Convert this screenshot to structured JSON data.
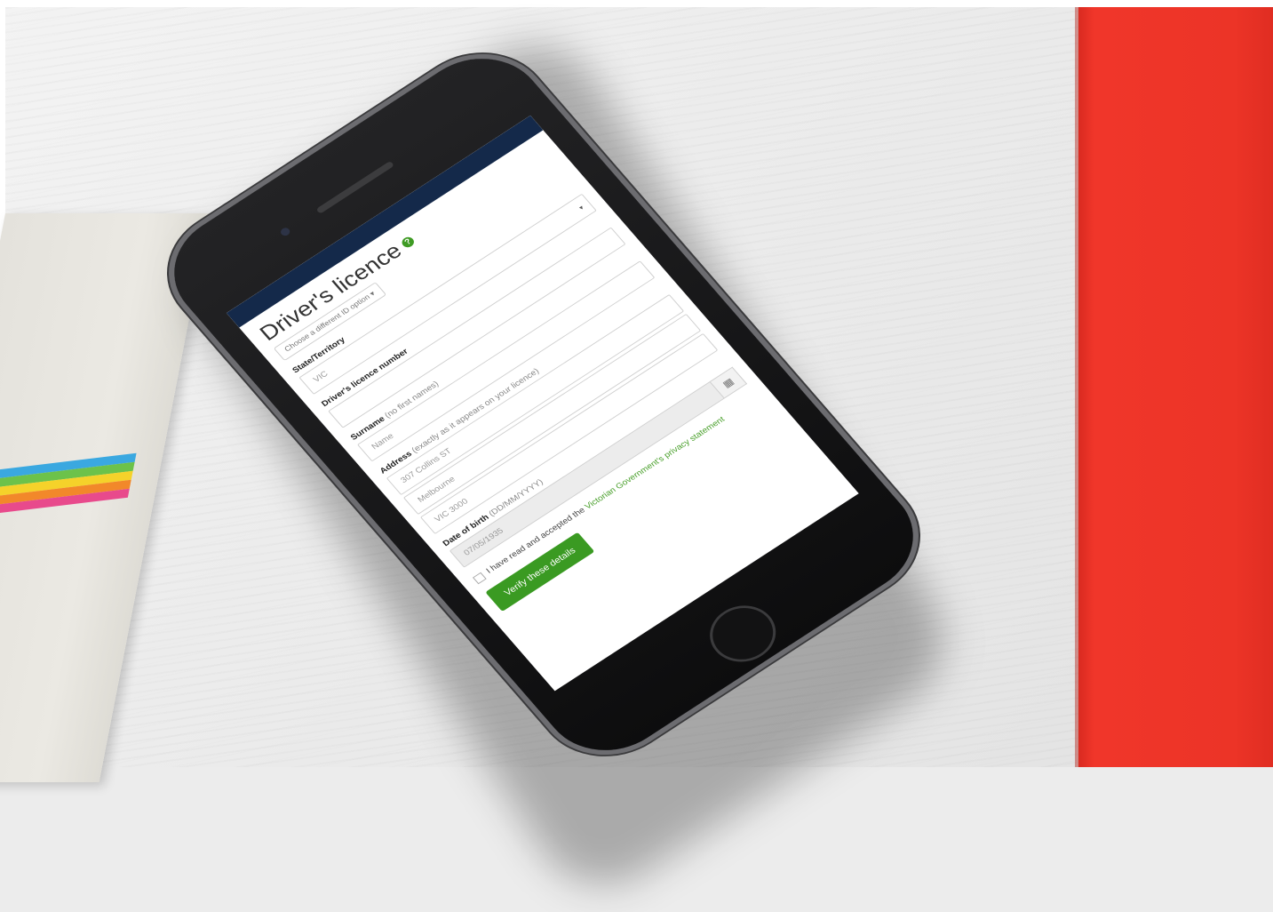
{
  "form": {
    "title": "Driver's licence",
    "id_option": "Choose a different ID option",
    "state_label": "State/Territory",
    "state_value": "VIC",
    "licence_label": "Driver's licence number",
    "licence_value": "",
    "surname_label": "Surname",
    "surname_hint": "(no first names)",
    "surname_value": "Name",
    "address_label": "Address",
    "address_hint": "(exactly as it appears on your licence)",
    "address_line1": "307 Collins ST",
    "address_line2": "Melbourne",
    "address_line3": "VIC 3000",
    "dob_label": "Date of birth",
    "dob_hint": "(DD/MM/YYYY)",
    "dob_value": "07/05/1935",
    "consent_text": "I have read and accepted the",
    "consent_link": "Victorian Government's privacy statement",
    "verify_button": "Verify these details"
  },
  "colors": {
    "header": "#14294a",
    "accent_green": "#3a9a22",
    "book_red": "#ec3427"
  },
  "icons": {
    "help": "help-circle-icon",
    "calendar": "calendar-icon",
    "caret": "caret-down-icon"
  }
}
